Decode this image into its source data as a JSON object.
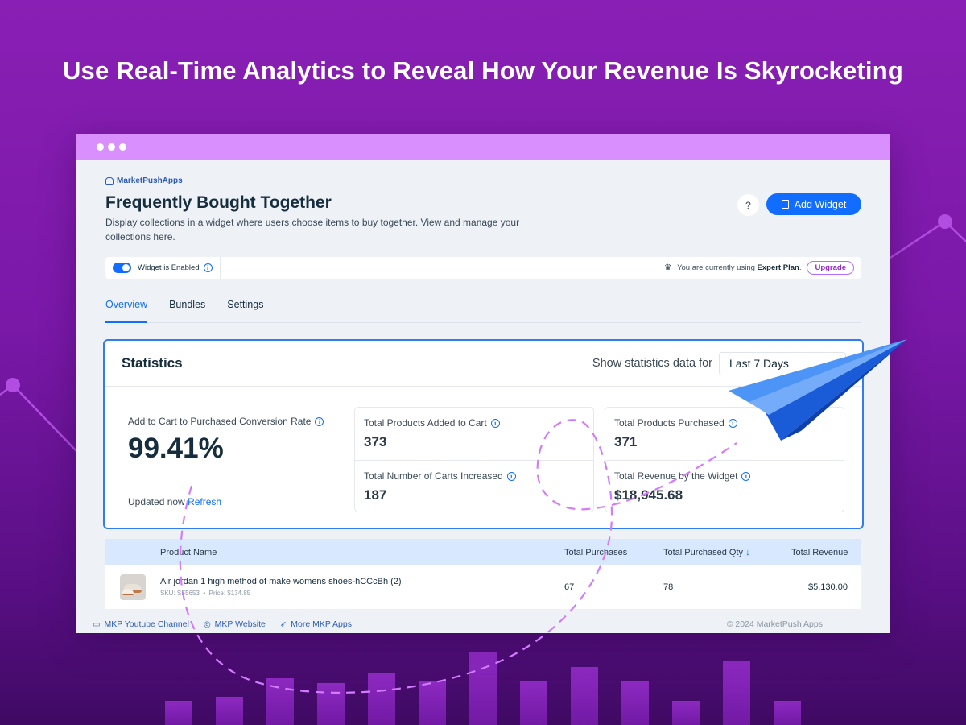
{
  "headline": "Use Real-Time Analytics to Reveal How Your Revenue Is Skyrocketing",
  "app": {
    "brand": "MarketPushApps",
    "title": "Frequently Bought Together",
    "description": "Display collections in a widget where users choose items to buy together. View and manage your collections here.",
    "help_label": "?",
    "add_widget_label": "Add Widget"
  },
  "widget_bar": {
    "enabled_label": "Widget is Enabled",
    "plan_prefix": "You are currently using ",
    "plan_name": "Expert Plan",
    "plan_suffix": ".",
    "upgrade_label": "Upgrade"
  },
  "tabs": [
    {
      "label": "Overview",
      "active": true
    },
    {
      "label": "Bundles",
      "active": false
    },
    {
      "label": "Settings",
      "active": false
    }
  ],
  "statistics": {
    "title": "Statistics",
    "range_label": "Show statistics data for",
    "range_value": "Last 7 Days",
    "conversion_label": "Add to Cart to Purchased Conversion Rate",
    "conversion_value": "99.41%",
    "updated_text": "Updated now",
    "refresh_label": "Refresh",
    "metrics": [
      {
        "label": "Total Products Added to Cart",
        "value": "373"
      },
      {
        "label": "Total Number of Carts Increased",
        "value": "187"
      },
      {
        "label": "Total Products Purchased",
        "value": "371"
      },
      {
        "label": "Total Revenue by the Widget",
        "value": "$18,945.68"
      }
    ]
  },
  "table": {
    "headers": {
      "product": "Product Name",
      "purchases": "Total Purchases",
      "qty": "Total Purchased Qty",
      "sort_arrow": "↓",
      "revenue": "Total Revenue"
    },
    "rows": [
      {
        "name": "Air jordan 1 high method of make womens shoes-hCCcBh (2)",
        "sku": "SKU: SF5653",
        "price": "Price: $134.85",
        "purchases": "67",
        "qty": "78",
        "revenue": "$5,130.00"
      }
    ]
  },
  "footer": {
    "youtube": "MKP Youtube Channel",
    "website": "MKP Website",
    "more_apps": "More MKP Apps",
    "copyright": "© 2024 MarketPush Apps"
  },
  "colors": {
    "background": "#8a1fb5",
    "titlebar": "#d98ffd",
    "accent": "#116dff",
    "table_header": "#d7e8ff",
    "dashed_path": "#d37bff",
    "plane": "#3f8cf6"
  },
  "icons": [
    "shopping-bag-icon",
    "info-icon",
    "crown-icon",
    "document-icon",
    "chevron-down-icon",
    "youtube-icon",
    "globe-icon",
    "rocket-icon",
    "paper-plane-icon"
  ]
}
